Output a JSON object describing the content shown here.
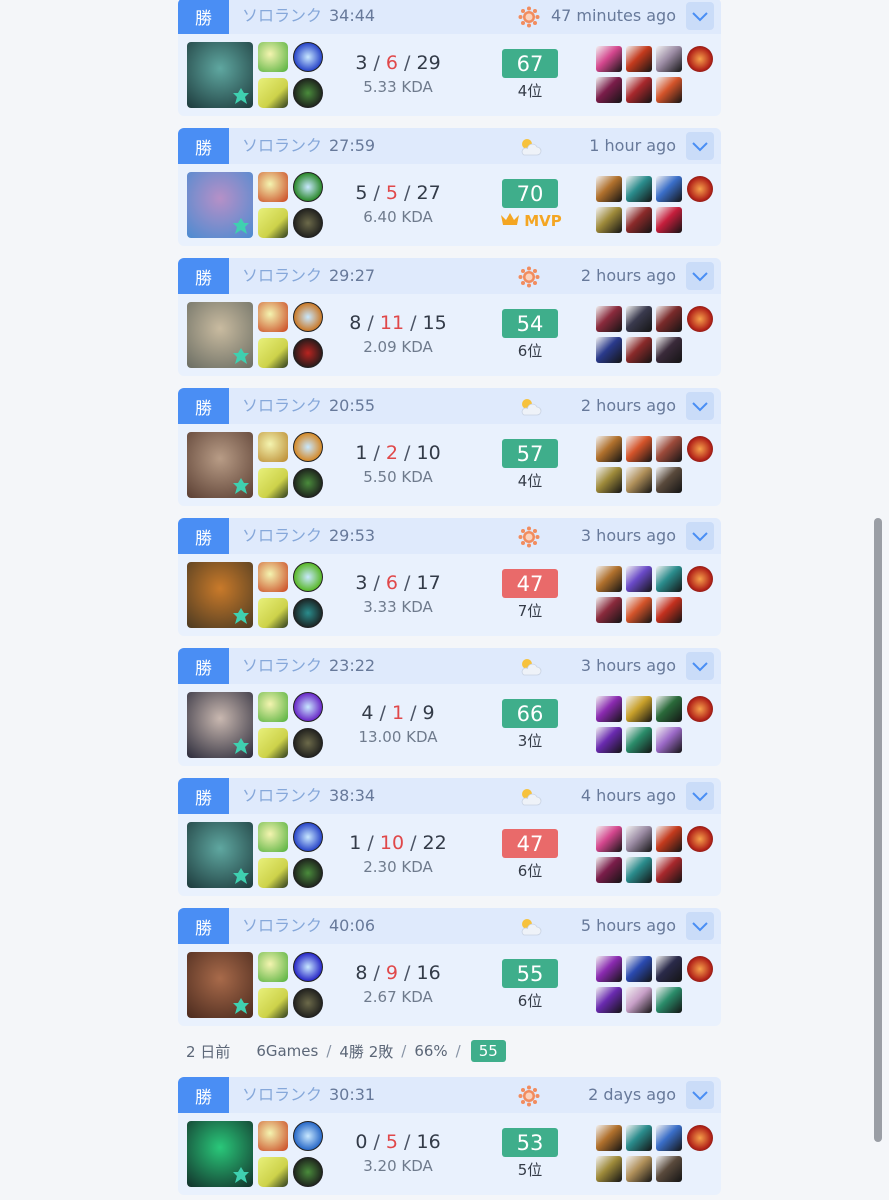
{
  "matches": [
    {
      "result": "勝",
      "queue": "ソロランク",
      "duration": "34:44",
      "weather": "sun",
      "time_ago": "47 minutes ago",
      "kills": "3",
      "deaths": "6",
      "assists": "29",
      "kda": "5.33 KDA",
      "score": "67",
      "score_color": "#3fae8b",
      "rank": "4位",
      "mvp": false,
      "champ_colors": [
        "#1d3a3c",
        "#5fa7a0"
      ],
      "spell_colors": [
        "#4fae3a",
        "#2a47c9"
      ],
      "rune_colors": [
        "#cdd24a",
        "#4a8b3c"
      ],
      "item_colors": [
        "#d4478e",
        "#c43a1d",
        "#9c8ca4",
        "#7b1d4a",
        "#a8282c",
        "#d4542a"
      ],
      "trinket_color": "#b3241a"
    },
    {
      "result": "勝",
      "queue": "ソロランク",
      "duration": "27:59",
      "weather": "cloud",
      "time_ago": "1 hour ago",
      "kills": "5",
      "deaths": "5",
      "assists": "27",
      "kda": "6.40 KDA",
      "score": "70",
      "score_color": "#3fae8b",
      "rank": "MVP",
      "mvp": true,
      "champ_colors": [
        "#4b8bd1",
        "#b690c7"
      ],
      "spell_colors": [
        "#c8421e",
        "#2e8a2e"
      ],
      "rune_colors": [
        "#cdd24a",
        "#6c6a4a"
      ],
      "item_colors": [
        "#b0702c",
        "#2a8c8c",
        "#3a6ec8",
        "#9e8a3a",
        "#8c2a2a",
        "#c61e3c"
      ],
      "trinket_color": "#b3241a"
    },
    {
      "result": "勝",
      "queue": "ソロランク",
      "duration": "29:27",
      "weather": "sun",
      "time_ago": "2 hours ago",
      "kills": "8",
      "deaths": "11",
      "assists": "15",
      "kda": "2.09 KDA",
      "score": "54",
      "score_color": "#3fae8b",
      "rank": "6位",
      "mvp": false,
      "champ_colors": [
        "#6a6d63",
        "#c9bba0"
      ],
      "spell_colors": [
        "#c8421e",
        "#c97a2a"
      ],
      "rune_colors": [
        "#cdd24a",
        "#b82420"
      ],
      "item_colors": [
        "#8a2a3c",
        "#3a3a4e",
        "#7a2a2a",
        "#2a3a8c",
        "#8a2a2a",
        "#3a2a3a"
      ],
      "trinket_color": "#b3241a"
    },
    {
      "result": "勝",
      "queue": "ソロランク",
      "duration": "20:55",
      "weather": "cloud",
      "time_ago": "2 hours ago",
      "kills": "1",
      "deaths": "2",
      "assists": "10",
      "kda": "5.50 KDA",
      "score": "57",
      "score_color": "#3fae8b",
      "rank": "4位",
      "mvp": false,
      "champ_colors": [
        "#5a3e32",
        "#b89c86"
      ],
      "spell_colors": [
        "#b8862c",
        "#d48a2a"
      ],
      "rune_colors": [
        "#cdd24a",
        "#4a8b3c"
      ],
      "item_colors": [
        "#b0702c",
        "#d4542a",
        "#9c4a3a",
        "#9e8a3a",
        "#b0905a",
        "#5a4a3c"
      ],
      "trinket_color": "#b3241a"
    },
    {
      "result": "勝",
      "queue": "ソロランク",
      "duration": "29:53",
      "weather": "sun",
      "time_ago": "3 hours ago",
      "kills": "3",
      "deaths": "6",
      "assists": "17",
      "kda": "3.33 KDA",
      "score": "47",
      "score_color": "#e96a6a",
      "rank": "7位",
      "mvp": false,
      "champ_colors": [
        "#4b3a22",
        "#c97a2a"
      ],
      "spell_colors": [
        "#c8421e",
        "#5ab82a"
      ],
      "rune_colors": [
        "#cdd24a",
        "#2a8c8c"
      ],
      "item_colors": [
        "#b0702c",
        "#6a4ac8",
        "#2a8c8c",
        "#8a2a3c",
        "#d4542a",
        "#c4301e"
      ],
      "trinket_color": "#b3241a"
    },
    {
      "result": "勝",
      "queue": "ソロランク",
      "duration": "23:22",
      "weather": "cloud",
      "time_ago": "3 hours ago",
      "kills": "4",
      "deaths": "1",
      "assists": "9",
      "kda": "13.00 KDA",
      "score": "66",
      "score_color": "#3fae8b",
      "rank": "3位",
      "mvp": false,
      "champ_colors": [
        "#2a2a3a",
        "#c9b8b0"
      ],
      "spell_colors": [
        "#4fae3a",
        "#6a2ac8"
      ],
      "rune_colors": [
        "#cdd24a",
        "#6c6a4a"
      ],
      "item_colors": [
        "#8a2ab0",
        "#c8a02a",
        "#2a6a3a",
        "#6a2ab0",
        "#2a8c6a",
        "#9c6ac8"
      ],
      "trinket_color": "#b3241a"
    },
    {
      "result": "勝",
      "queue": "ソロランク",
      "duration": "38:34",
      "weather": "cloud",
      "time_ago": "4 hours ago",
      "kills": "1",
      "deaths": "10",
      "assists": "22",
      "kda": "2.30 KDA",
      "score": "47",
      "score_color": "#e96a6a",
      "rank": "6位",
      "mvp": false,
      "champ_colors": [
        "#1d3a3c",
        "#5fa7a0"
      ],
      "spell_colors": [
        "#4fae3a",
        "#2a47c9"
      ],
      "rune_colors": [
        "#cdd24a",
        "#4a8b3c"
      ],
      "item_colors": [
        "#d4478e",
        "#9c8ca4",
        "#c43a1d",
        "#7b1d4a",
        "#2a8c8c",
        "#a8282c"
      ],
      "trinket_color": "#b3241a"
    },
    {
      "result": "勝",
      "queue": "ソロランク",
      "duration": "40:06",
      "weather": "cloud",
      "time_ago": "5 hours ago",
      "kills": "8",
      "deaths": "9",
      "assists": "16",
      "kda": "2.67 KDA",
      "score": "55",
      "score_color": "#3fae8b",
      "rank": "6位",
      "mvp": false,
      "champ_colors": [
        "#4a2a1e",
        "#a86a4a"
      ],
      "spell_colors": [
        "#4fae3a",
        "#2a2ac8"
      ],
      "rune_colors": [
        "#cdd24a",
        "#6c6a4a"
      ],
      "item_colors": [
        "#8a2ab0",
        "#2a4ab0",
        "#2a2a4a",
        "#6a2ab0",
        "#c8a0c8",
        "#2a8c6a"
      ],
      "trinket_color": "#b3241a"
    },
    {
      "result": "勝",
      "queue": "ソロランク",
      "duration": "30:31",
      "weather": "sun",
      "time_ago": "2 days ago",
      "kills": "0",
      "deaths": "5",
      "assists": "16",
      "kda": "3.20 KDA",
      "score": "53",
      "score_color": "#3fae8b",
      "rank": "5位",
      "mvp": false,
      "champ_colors": [
        "#12302a",
        "#2ac87a"
      ],
      "spell_colors": [
        "#c8421e",
        "#2a6ac8"
      ],
      "rune_colors": [
        "#cdd24a",
        "#4a8b3c"
      ],
      "item_colors": [
        "#b0702c",
        "#2a8c8c",
        "#3a6ec8",
        "#9e8a3a",
        "#b0905a",
        "#5a4a3c"
      ],
      "trinket_color": "#b3241a"
    }
  ],
  "day_summary": {
    "day": "2 日前",
    "games": "6Games",
    "record": "4勝 2敗",
    "winrate": "66%",
    "avg_score": "55"
  }
}
